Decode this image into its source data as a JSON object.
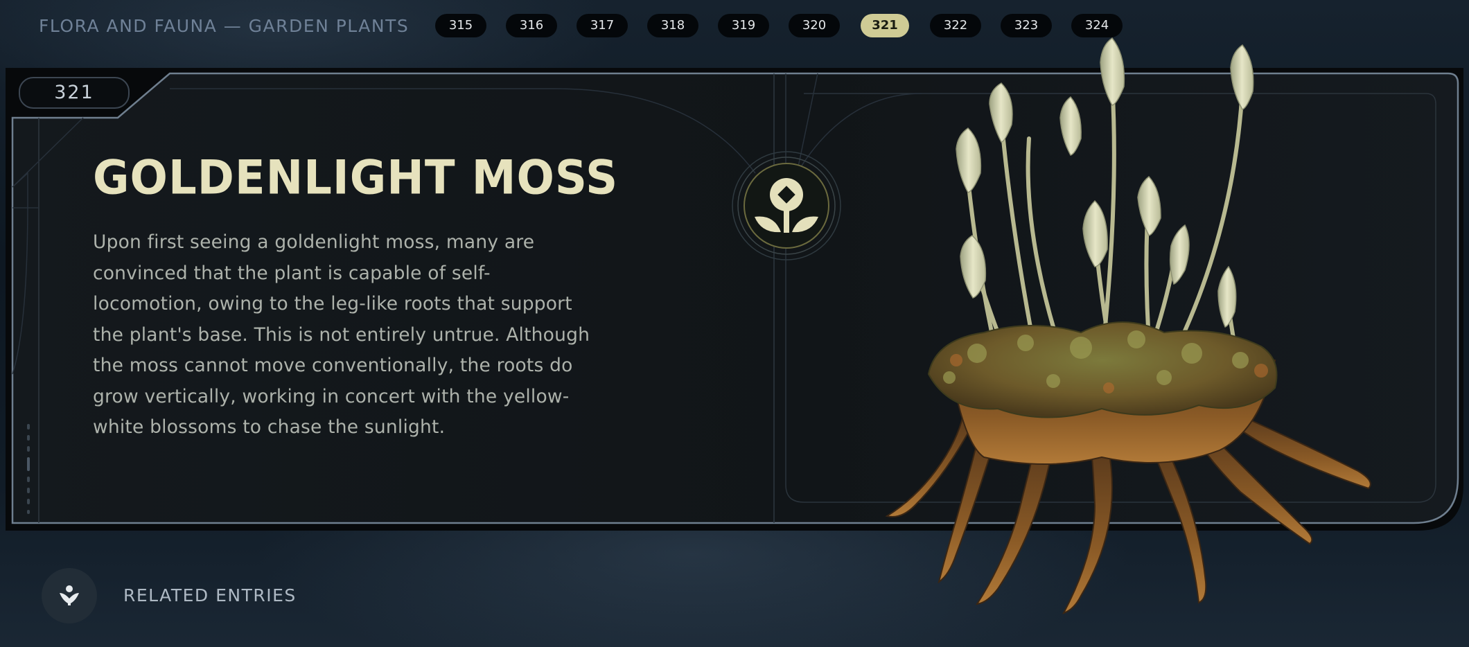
{
  "header": {
    "category_title": "FLORA AND FAUNA — GARDEN PLANTS",
    "entry_tabs": [
      "315",
      "316",
      "317",
      "318",
      "319",
      "320",
      "321",
      "322",
      "323",
      "324"
    ],
    "active_tab": "321"
  },
  "entry": {
    "number": "321",
    "title": "GOLDENLIGHT MOSS",
    "description": "Upon first seeing a goldenlight moss, many are convinced that the plant is capable of self-locomotion, owing to the leg-like roots that support the plant's base. This is not entirely untrue. Although the moss cannot move conventionally, the roots do grow vertically, working in concert with the yellow-white blossoms to chase the sunlight."
  },
  "footer": {
    "related_label": "RELATED ENTRIES"
  },
  "icons": {
    "category_emblem": "plant-sprout-icon",
    "related_button": "related-entries-icon"
  },
  "colors": {
    "accent": "#cfcb95",
    "title": "#e6e2bd",
    "panel_border": "#6f7f8f",
    "panel_bg": "#121619"
  }
}
